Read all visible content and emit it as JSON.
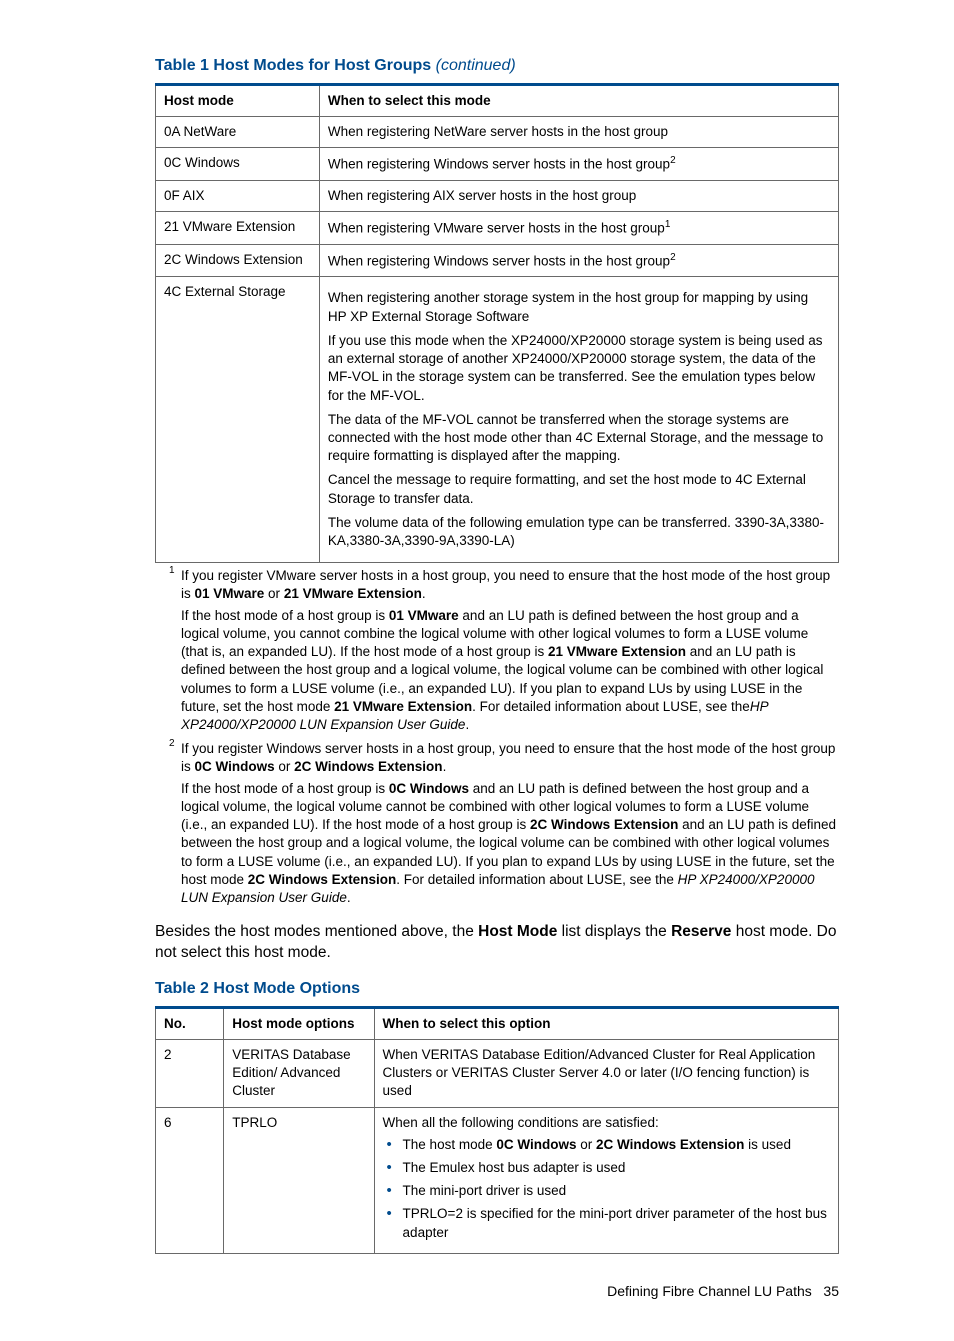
{
  "table1": {
    "title_prefix": "Table 1 Host Modes for Host Groups ",
    "title_suffix": "(continued)",
    "headers": [
      "Host mode",
      "When to select this mode"
    ]
  },
  "t1": {
    "r0c0": "0A NetWare",
    "r0c1": "When registering NetWare server hosts in the host group",
    "r1c0": "0C Windows",
    "r1c1": "When registering Windows server hosts in the host group",
    "r1sup": "2",
    "r2c0": "0F AIX",
    "r2c1": "When registering AIX server hosts in the host group",
    "r3c0": "21 VMware Extension",
    "r3c1": "When registering VMware server hosts in the host group",
    "r3sup": "1",
    "r4c0": "2C Windows Extension",
    "r4c1": "When registering Windows server hosts in the host group",
    "r4sup": "2",
    "r5c0": "4C External Storage",
    "r5p0": "When registering another storage system in the host group for mapping by using HP XP External Storage Software",
    "r5p1": "If you use this mode when the XP24000/XP20000 storage system is being used as an external storage of another XP24000/XP20000 storage system, the data of the MF-VOL in the storage system can be transferred. See the emulation types below for the MF-VOL.",
    "r5p2": "The data of the MF-VOL cannot be transferred when the storage systems are connected with the host mode other than 4C External Storage, and the message to require formatting is displayed after the mapping.",
    "r5p3": "Cancel the message to require formatting, and set the host mode to 4C External Storage to transfer data.",
    "r5p4": "The volume data of the following emulation type can be transferred. 3390-3A,3380-KA,3380-3A,3390-9A,3390-LA)"
  },
  "fn": {
    "idx1": "1",
    "idx2": "2",
    "f1a_pre": "If you register VMware server hosts in a host group, you need to ensure that the host mode of the host group is ",
    "f1a_b1": "01 VMware",
    "f1a_mid": " or ",
    "f1a_b2": "21 VMware Extension",
    "f1a_post": ".",
    "f1b_pre": "If the host mode of a host group is ",
    "f1b_b1": "01 VMware",
    "f1b_post": " and an LU path is defined between the host group and a logical volume, you cannot combine the logical volume with other logical volumes to form a LUSE volume (that is, an expanded LU). If the host mode of a host group is ",
    "f1b_b2": "21 VMware Extension",
    "f1b_post2": " and an LU path is defined between the host group and a logical volume, the logical volume can be combined with other logical volumes to form a LUSE volume (i.e., an expanded LU). If you plan to expand LUs by using LUSE in the future, set the host mode ",
    "f1b_b3": "21 VMware Extension",
    "f1b_post3": ". For detailed information about LUSE, see the",
    "f1b_i": "HP XP24000/XP20000 LUN Expansion User Guide",
    "f1b_end": ".",
    "f2a_pre": "If you register Windows server hosts in a host group, you need to ensure that the host mode of the host group is ",
    "f2a_b1": "0C Windows",
    "f2a_mid": " or ",
    "f2a_b2": "2C Windows Extension",
    "f2a_post": ".",
    "f2b_pre": "If the host mode of a host group is ",
    "f2b_b1": "0C Windows",
    "f2b_post": " and an LU path is defined between the host group and a logical volume, the logical volume cannot be combined with other logical volumes to form a LUSE volume (i.e., an expanded LU). If the host mode of a host group is ",
    "f2b_b2": "2C Windows Extension",
    "f2b_post2": " and an LU path is defined between the host group and a logical volume, the logical volume can be combined with other logical volumes to form a LUSE volume (i.e., an expanded LU). If you plan to expand LUs by using LUSE in the future, set the host mode ",
    "f2b_b3": "2C Windows Extension",
    "f2b_post3": ". For detailed information about LUSE, see the ",
    "f2b_i": "HP XP24000/XP20000 LUN Expansion User Guide",
    "f2b_end": "."
  },
  "body": {
    "pre": "Besides the host modes mentioned above, the ",
    "b1": "Host Mode",
    "mid": " list displays the ",
    "b2": "Reserve",
    "post": " host mode. Do not select this host mode."
  },
  "table2": {
    "title": "Table 2 Host Mode Options",
    "headers": [
      "No.",
      "Host mode options",
      "When to select this option"
    ]
  },
  "t2": {
    "r0c0": "2",
    "r0c1": "VERITAS Database Edition/ Advanced Cluster",
    "r0c2": "When VERITAS Database Edition/Advanced Cluster for Real Application Clusters or VERITAS Cluster Server 4.0 or later (I/O fencing function) is used",
    "r1c0": "6",
    "r1c1": "TPRLO",
    "r1lead": "When all the following conditions are satisfied:",
    "r1li0_pre": "The host mode ",
    "r1li0_b1": "0C Windows",
    "r1li0_mid": " or ",
    "r1li0_b2": "2C Windows Extension",
    "r1li0_post": " is used",
    "r1li1": "The Emulex host bus adapter is used",
    "r1li2": "The mini-port driver is used",
    "r1li3": "TPRLO=2 is specified for the mini-port driver parameter of the host bus adapter"
  },
  "footer": {
    "text": "Defining Fibre Channel LU Paths",
    "page": "35"
  }
}
